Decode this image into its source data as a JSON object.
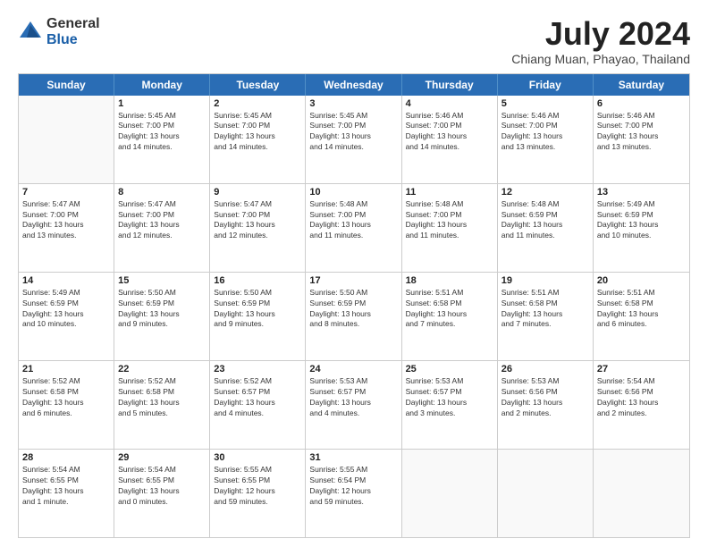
{
  "header": {
    "logo_general": "General",
    "logo_blue": "Blue",
    "month_year": "July 2024",
    "location": "Chiang Muan, Phayao, Thailand"
  },
  "days_of_week": [
    "Sunday",
    "Monday",
    "Tuesday",
    "Wednesday",
    "Thursday",
    "Friday",
    "Saturday"
  ],
  "weeks": [
    [
      {
        "day": "",
        "info": ""
      },
      {
        "day": "1",
        "info": "Sunrise: 5:45 AM\nSunset: 7:00 PM\nDaylight: 13 hours\nand 14 minutes."
      },
      {
        "day": "2",
        "info": "Sunrise: 5:45 AM\nSunset: 7:00 PM\nDaylight: 13 hours\nand 14 minutes."
      },
      {
        "day": "3",
        "info": "Sunrise: 5:45 AM\nSunset: 7:00 PM\nDaylight: 13 hours\nand 14 minutes."
      },
      {
        "day": "4",
        "info": "Sunrise: 5:46 AM\nSunset: 7:00 PM\nDaylight: 13 hours\nand 14 minutes."
      },
      {
        "day": "5",
        "info": "Sunrise: 5:46 AM\nSunset: 7:00 PM\nDaylight: 13 hours\nand 13 minutes."
      },
      {
        "day": "6",
        "info": "Sunrise: 5:46 AM\nSunset: 7:00 PM\nDaylight: 13 hours\nand 13 minutes."
      }
    ],
    [
      {
        "day": "7",
        "info": "Sunrise: 5:47 AM\nSunset: 7:00 PM\nDaylight: 13 hours\nand 13 minutes."
      },
      {
        "day": "8",
        "info": "Sunrise: 5:47 AM\nSunset: 7:00 PM\nDaylight: 13 hours\nand 12 minutes."
      },
      {
        "day": "9",
        "info": "Sunrise: 5:47 AM\nSunset: 7:00 PM\nDaylight: 13 hours\nand 12 minutes."
      },
      {
        "day": "10",
        "info": "Sunrise: 5:48 AM\nSunset: 7:00 PM\nDaylight: 13 hours\nand 11 minutes."
      },
      {
        "day": "11",
        "info": "Sunrise: 5:48 AM\nSunset: 7:00 PM\nDaylight: 13 hours\nand 11 minutes."
      },
      {
        "day": "12",
        "info": "Sunrise: 5:48 AM\nSunset: 6:59 PM\nDaylight: 13 hours\nand 11 minutes."
      },
      {
        "day": "13",
        "info": "Sunrise: 5:49 AM\nSunset: 6:59 PM\nDaylight: 13 hours\nand 10 minutes."
      }
    ],
    [
      {
        "day": "14",
        "info": "Sunrise: 5:49 AM\nSunset: 6:59 PM\nDaylight: 13 hours\nand 10 minutes."
      },
      {
        "day": "15",
        "info": "Sunrise: 5:50 AM\nSunset: 6:59 PM\nDaylight: 13 hours\nand 9 minutes."
      },
      {
        "day": "16",
        "info": "Sunrise: 5:50 AM\nSunset: 6:59 PM\nDaylight: 13 hours\nand 9 minutes."
      },
      {
        "day": "17",
        "info": "Sunrise: 5:50 AM\nSunset: 6:59 PM\nDaylight: 13 hours\nand 8 minutes."
      },
      {
        "day": "18",
        "info": "Sunrise: 5:51 AM\nSunset: 6:58 PM\nDaylight: 13 hours\nand 7 minutes."
      },
      {
        "day": "19",
        "info": "Sunrise: 5:51 AM\nSunset: 6:58 PM\nDaylight: 13 hours\nand 7 minutes."
      },
      {
        "day": "20",
        "info": "Sunrise: 5:51 AM\nSunset: 6:58 PM\nDaylight: 13 hours\nand 6 minutes."
      }
    ],
    [
      {
        "day": "21",
        "info": "Sunrise: 5:52 AM\nSunset: 6:58 PM\nDaylight: 13 hours\nand 6 minutes."
      },
      {
        "day": "22",
        "info": "Sunrise: 5:52 AM\nSunset: 6:58 PM\nDaylight: 13 hours\nand 5 minutes."
      },
      {
        "day": "23",
        "info": "Sunrise: 5:52 AM\nSunset: 6:57 PM\nDaylight: 13 hours\nand 4 minutes."
      },
      {
        "day": "24",
        "info": "Sunrise: 5:53 AM\nSunset: 6:57 PM\nDaylight: 13 hours\nand 4 minutes."
      },
      {
        "day": "25",
        "info": "Sunrise: 5:53 AM\nSunset: 6:57 PM\nDaylight: 13 hours\nand 3 minutes."
      },
      {
        "day": "26",
        "info": "Sunrise: 5:53 AM\nSunset: 6:56 PM\nDaylight: 13 hours\nand 2 minutes."
      },
      {
        "day": "27",
        "info": "Sunrise: 5:54 AM\nSunset: 6:56 PM\nDaylight: 13 hours\nand 2 minutes."
      }
    ],
    [
      {
        "day": "28",
        "info": "Sunrise: 5:54 AM\nSunset: 6:55 PM\nDaylight: 13 hours\nand 1 minute."
      },
      {
        "day": "29",
        "info": "Sunrise: 5:54 AM\nSunset: 6:55 PM\nDaylight: 13 hours\nand 0 minutes."
      },
      {
        "day": "30",
        "info": "Sunrise: 5:55 AM\nSunset: 6:55 PM\nDaylight: 12 hours\nand 59 minutes."
      },
      {
        "day": "31",
        "info": "Sunrise: 5:55 AM\nSunset: 6:54 PM\nDaylight: 12 hours\nand 59 minutes."
      },
      {
        "day": "",
        "info": ""
      },
      {
        "day": "",
        "info": ""
      },
      {
        "day": "",
        "info": ""
      }
    ]
  ]
}
